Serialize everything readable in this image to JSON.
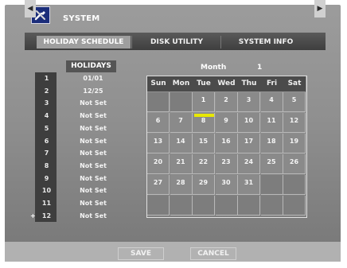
{
  "window": {
    "title": "SYSTEM",
    "icon": "tools-icon"
  },
  "tabs": [
    {
      "label": "HOLIDAY SCHEDULE",
      "active": true
    },
    {
      "label": "DISK UTILITY",
      "active": false
    },
    {
      "label": "SYSTEM INFO",
      "active": false
    }
  ],
  "holidays": {
    "header": "HOLIDAYS",
    "rows": [
      {
        "num": "1",
        "value": "01/01"
      },
      {
        "num": "2",
        "value": "12/25"
      },
      {
        "num": "3",
        "value": "Not Set"
      },
      {
        "num": "4",
        "value": "Not Set"
      },
      {
        "num": "5",
        "value": "Not Set"
      },
      {
        "num": "6",
        "value": "Not Set"
      },
      {
        "num": "7",
        "value": "Not Set"
      },
      {
        "num": "8",
        "value": "Not Set"
      },
      {
        "num": "9",
        "value": "Not Set"
      },
      {
        "num": "10",
        "value": "Not Set"
      },
      {
        "num": "11",
        "value": "Not Set"
      },
      {
        "num": "12",
        "value": "Not Set",
        "marker": "+"
      }
    ]
  },
  "calendar": {
    "month_label": "Month",
    "month_value": "1",
    "days": [
      "Sun",
      "Mon",
      "Tue",
      "Wed",
      "Thu",
      "Fri",
      "Sat"
    ],
    "weeks": [
      [
        "",
        "",
        "1",
        "2",
        "3",
        "4",
        "5"
      ],
      [
        "6",
        "7",
        "8",
        "9",
        "10",
        "11",
        "12"
      ],
      [
        "13",
        "14",
        "15",
        "16",
        "17",
        "18",
        "19"
      ],
      [
        "20",
        "21",
        "22",
        "23",
        "24",
        "25",
        "26"
      ],
      [
        "27",
        "28",
        "29",
        "30",
        "31",
        "",
        ""
      ],
      [
        "",
        "",
        "",
        "",
        "",
        "",
        ""
      ]
    ],
    "selected": "1",
    "highlight_color": "#e8e800"
  },
  "buttons": {
    "save": "SAVE",
    "cancel": "CANCEL"
  }
}
